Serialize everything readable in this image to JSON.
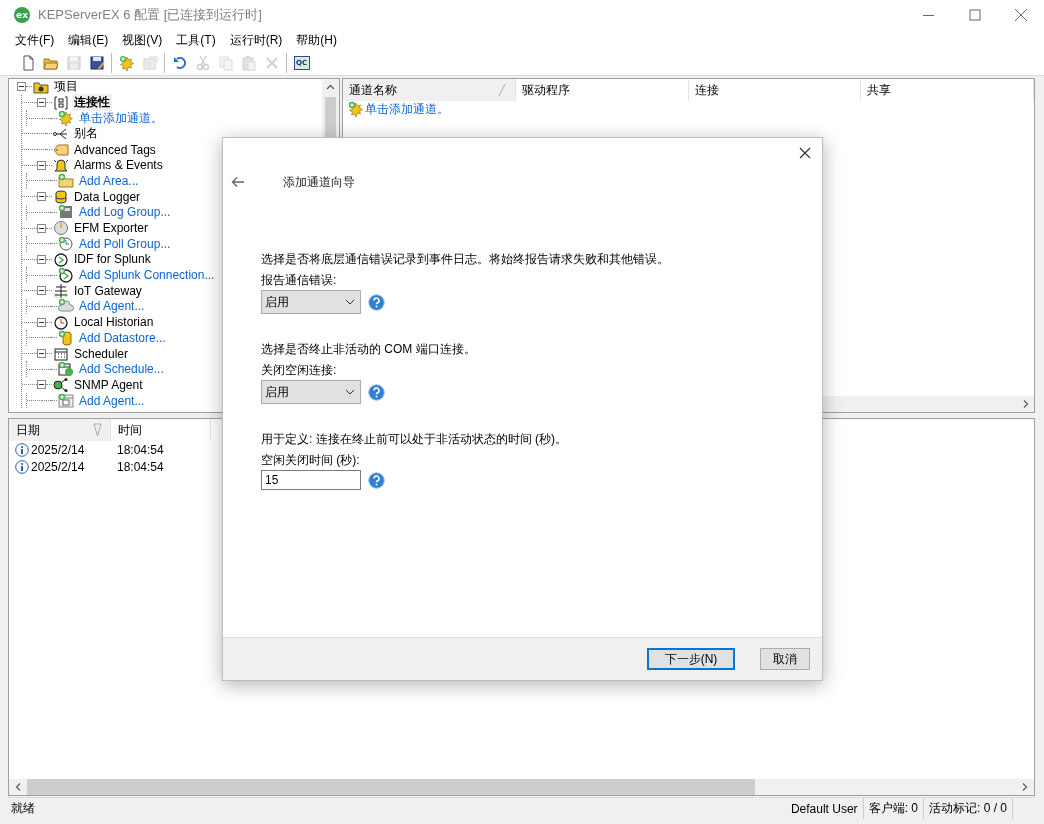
{
  "window": {
    "logo_text": "ex",
    "title": "KEPServerEX 6 配置 [已连接到运行时]"
  },
  "menu": [
    "文件(F)",
    "编辑(E)",
    "视图(V)",
    "工具(T)",
    "运行时(R)",
    "帮助(H)"
  ],
  "toolbar": [
    {
      "kind": "new",
      "disabled": false
    },
    {
      "kind": "open",
      "disabled": false
    },
    {
      "kind": "save",
      "disabled": true
    },
    {
      "kind": "save-as",
      "disabled": false
    },
    {
      "kind": "separator"
    },
    {
      "kind": "add-channel",
      "disabled": false
    },
    {
      "kind": "properties",
      "disabled": true
    },
    {
      "kind": "separator"
    },
    {
      "kind": "undo",
      "disabled": false
    },
    {
      "kind": "cut",
      "disabled": true
    },
    {
      "kind": "copy",
      "disabled": true
    },
    {
      "kind": "paste",
      "disabled": true
    },
    {
      "kind": "delete",
      "disabled": true
    },
    {
      "kind": "separator"
    },
    {
      "kind": "quick-client",
      "label": "QC",
      "disabled": false
    }
  ],
  "project_tree": {
    "items": [
      {
        "label": "项目",
        "kind": "node",
        "selected": false,
        "expanded": true,
        "children": [
          {
            "label": "连接性",
            "kind": "node",
            "selected": true,
            "expanded": true,
            "children": [
              {
                "label": "单击添加通道。",
                "kind": "action",
                "selected": false
              }
            ]
          },
          {
            "label": "别名",
            "kind": "node",
            "selected": false
          },
          {
            "label": "Advanced Tags",
            "kind": "node",
            "selected": false
          },
          {
            "label": "Alarms & Events",
            "kind": "node",
            "selected": false,
            "expanded": true,
            "children": [
              {
                "label": "Add Area...",
                "kind": "action",
                "selected": false
              }
            ]
          },
          {
            "label": "Data Logger",
            "kind": "node",
            "selected": false,
            "expanded": true,
            "children": [
              {
                "label": "Add Log Group...",
                "kind": "action",
                "selected": false
              }
            ]
          },
          {
            "label": "EFM Exporter",
            "kind": "node",
            "selected": false,
            "expanded": true,
            "children": [
              {
                "label": "Add Poll Group...",
                "kind": "action",
                "selected": false
              }
            ]
          },
          {
            "label": "IDF for Splunk",
            "kind": "node",
            "selected": false,
            "expanded": true,
            "children": [
              {
                "label": "Add Splunk Connection...",
                "kind": "action",
                "selected": false
              }
            ]
          },
          {
            "label": "IoT Gateway",
            "kind": "node",
            "selected": false,
            "expanded": true,
            "children": [
              {
                "label": "Add Agent...",
                "kind": "action",
                "selected": false
              }
            ]
          },
          {
            "label": "Local Historian",
            "kind": "node",
            "selected": false,
            "expanded": true,
            "children": [
              {
                "label": "Add Datastore...",
                "kind": "action",
                "selected": false
              }
            ]
          },
          {
            "label": "Scheduler",
            "kind": "node",
            "selected": false,
            "expanded": true,
            "children": [
              {
                "label": "Add Schedule...",
                "kind": "action",
                "selected": false
              }
            ]
          },
          {
            "label": "SNMP Agent",
            "kind": "node",
            "selected": false,
            "expanded": true,
            "children": [
              {
                "label": "Add Agent...",
                "kind": "action",
                "selected": false
              }
            ]
          }
        ]
      }
    ]
  },
  "channel_list": {
    "columns": [
      {
        "label": "通道名称",
        "sorted": true
      },
      {
        "label": "驱动程序",
        "sorted": false
      },
      {
        "label": "连接",
        "sorted": false
      },
      {
        "label": "共享",
        "sorted": false
      }
    ],
    "rows": [
      {
        "label": "单击添加通道。",
        "kind": "action"
      }
    ]
  },
  "event_log": {
    "columns": [
      {
        "label": "日期",
        "sorted": true
      },
      {
        "label": "时间",
        "sorted": false
      }
    ],
    "rows": [
      {
        "date": "2025/2/14",
        "time": "18:04:54"
      },
      {
        "date": "2025/2/14",
        "time": "18:04:54"
      }
    ]
  },
  "status_bar": {
    "text": "就绪",
    "user": "Default User",
    "clients": "客户端: 0",
    "active_tags": "活动标记: 0 / 0"
  },
  "dialog": {
    "title": "添加通道向导",
    "sections": [
      {
        "description": "选择是否将底层通信错误记录到事件日志。将始终报告请求失败和其他错误。",
        "label": "报告通信错误:",
        "kind": "select",
        "value": "启用"
      },
      {
        "description": "选择是否终止非活动的 COM 端口连接。",
        "label": "关闭空闲连接:",
        "kind": "select",
        "value": "启用"
      },
      {
        "description": "用于定义: 连接在终止前可以处于非活动状态的时间 (秒)。",
        "label": "空闲关闭时间 (秒):",
        "kind": "input",
        "value": "15"
      }
    ],
    "buttons": [
      {
        "label": "下一步(N)",
        "default": true
      },
      {
        "label": "取消",
        "default": false
      }
    ]
  }
}
